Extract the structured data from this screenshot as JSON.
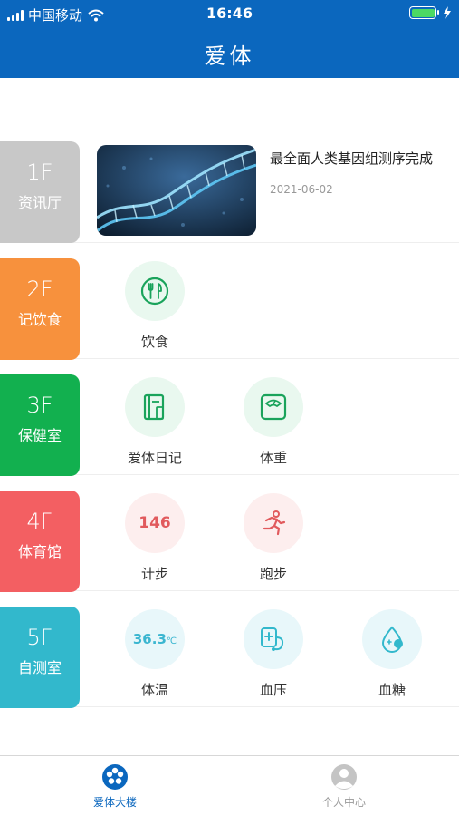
{
  "status": {
    "carrier": "中国移动",
    "time": "16:46"
  },
  "header": {
    "title": "爱体"
  },
  "floors": [
    {
      "num": "1F",
      "name": "资讯厅",
      "color": "#c8c8c8"
    },
    {
      "num": "2F",
      "name": "记饮食",
      "color": "#f7913d"
    },
    {
      "num": "3F",
      "name": "保健室",
      "color": "#12b04f"
    },
    {
      "num": "4F",
      "name": "体育馆",
      "color": "#f35f62"
    },
    {
      "num": "5F",
      "name": "自测室",
      "color": "#32b8cc"
    }
  ],
  "news": {
    "title": "最全面人类基因组测序完成",
    "date": "2021-06-02"
  },
  "entries": {
    "diet": {
      "label": "饮食",
      "icon": "fork-knife-icon"
    },
    "diary": {
      "label": "爱体日记",
      "icon": "diary-icon"
    },
    "weight": {
      "label": "体重",
      "icon": "scale-icon"
    },
    "steps": {
      "label": "计步",
      "value": "146"
    },
    "running": {
      "label": "跑步",
      "icon": "runner-icon"
    },
    "temperature": {
      "label": "体温",
      "value": "36.3",
      "unit": "℃"
    },
    "blood_pressure": {
      "label": "血压",
      "icon": "blood-pressure-icon"
    },
    "blood_sugar": {
      "label": "血糖",
      "icon": "blood-drop-icon"
    }
  },
  "tabbar": [
    {
      "label": "爱体大楼",
      "active": true,
      "color": "#0B67BE"
    },
    {
      "label": "个人中心",
      "active": false,
      "color": "#999999"
    }
  ]
}
